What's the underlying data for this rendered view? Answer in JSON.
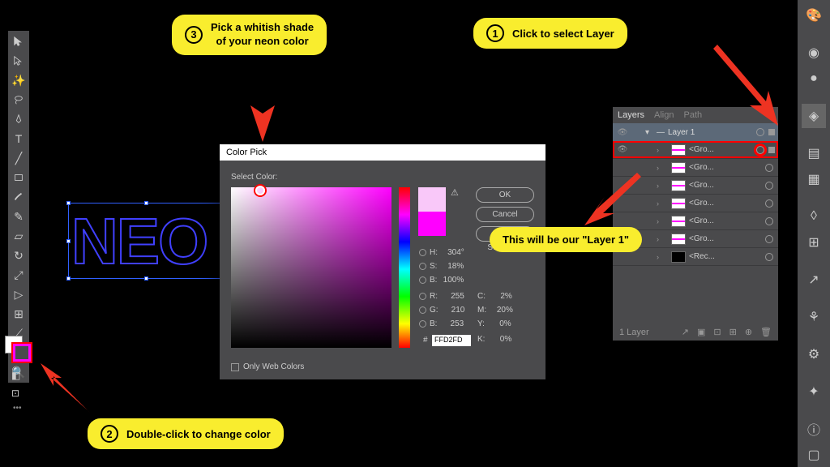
{
  "neo_text": "NEO",
  "color_picker": {
    "title": "Color Pick",
    "select_label": "Select Color:",
    "ok": "OK",
    "cancel": "Cancel",
    "swatches": "Color Swatches",
    "h": {
      "label": "H:",
      "value": "304°"
    },
    "s": {
      "label": "S:",
      "value": "18%"
    },
    "b": {
      "label": "B:",
      "value": "100%"
    },
    "r": {
      "label": "R:",
      "value": "255"
    },
    "g": {
      "label": "G:",
      "value": "210"
    },
    "b2": {
      "label": "B:",
      "value": "253"
    },
    "c": {
      "label": "C:",
      "value": "2%"
    },
    "m": {
      "label": "M:",
      "value": "20%"
    },
    "y": {
      "label": "Y:",
      "value": "0%"
    },
    "k": {
      "label": "K:",
      "value": "0%"
    },
    "hex_label": "#",
    "hex": "FFD2FD",
    "web_only": "Only Web Colors"
  },
  "layers": {
    "tab1": "Layers",
    "tab2": "Align",
    "tab3": "Path",
    "header": "Layer 1",
    "items": [
      "<Gro...",
      "<Gro...",
      "<Gro...",
      "<Gro...",
      "<Gro...",
      "<Gro...",
      "<Rec..."
    ],
    "footer": "1 Layer"
  },
  "callouts": {
    "c1": {
      "num": "1",
      "text": "Click to select Layer"
    },
    "c2": {
      "num": "2",
      "text": "Double-click to change color"
    },
    "c3": {
      "num": "3",
      "text": "Pick a whitish shade\nof your neon color"
    },
    "c4": {
      "text": "This will be our \"Layer 1\""
    }
  }
}
